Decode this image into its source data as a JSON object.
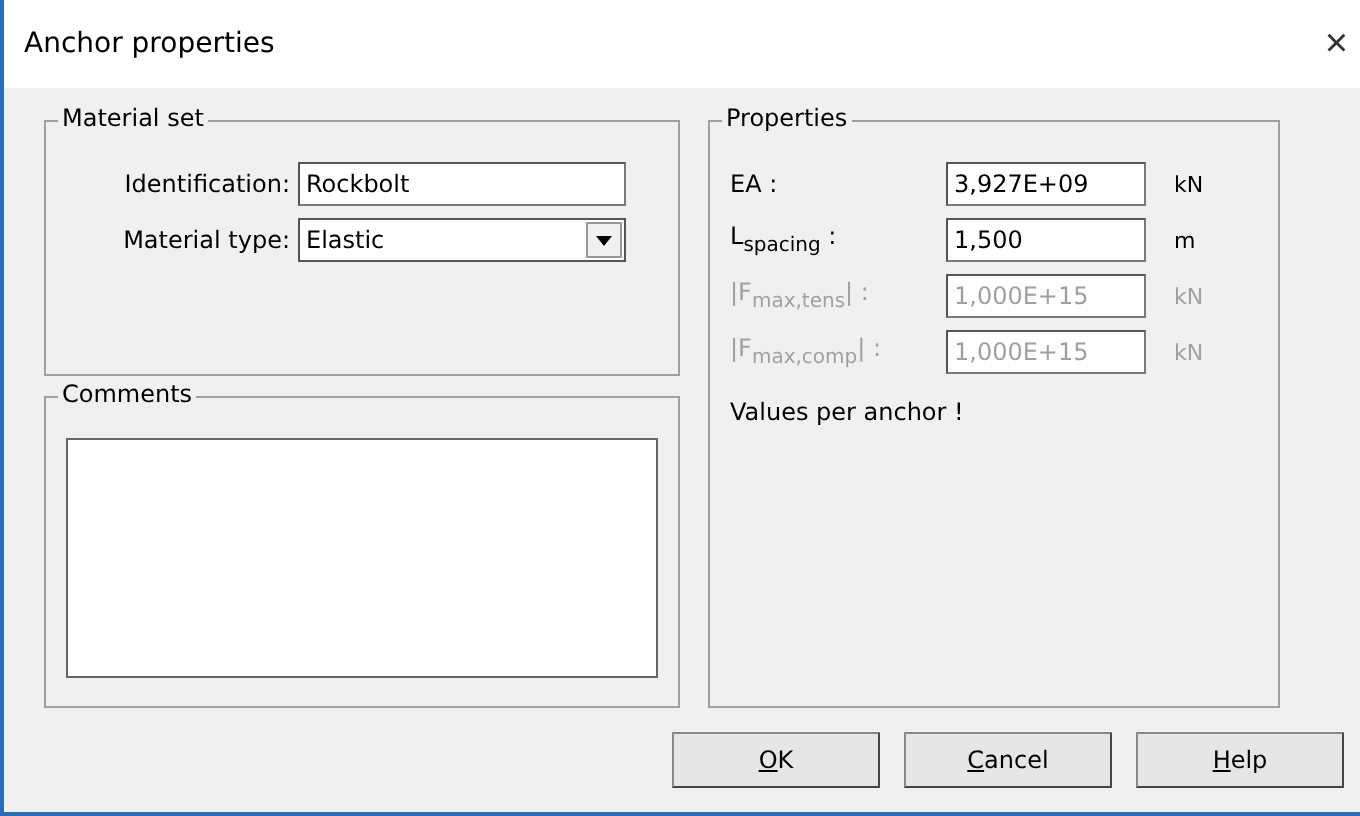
{
  "window": {
    "title": "Anchor properties",
    "close": "×"
  },
  "material_set": {
    "title": "Material set",
    "identification": {
      "label": "Identification:",
      "value": "Rockbolt"
    },
    "material_type": {
      "label": "Material type:",
      "value": "Elastic"
    }
  },
  "comments": {
    "title": "Comments"
  },
  "properties": {
    "title": "Properties",
    "rows": [
      {
        "label": "EA :",
        "value": "3,927E+09",
        "unit": "kN",
        "disabled": false
      },
      {
        "label": "L$_{spacing}$ :",
        "value": "1,500",
        "unit": "m",
        "disabled": false
      },
      {
        "label": "|F$_{max,tens}$| :",
        "value": "1,000E+15",
        "unit": "kN",
        "disabled": true
      },
      {
        "label": "|F$_{max,comp}$| :",
        "value": "1,000E+15",
        "unit": "kN",
        "disabled": true
      }
    ],
    "note": "Values per anchor !"
  },
  "buttons": [
    "OK",
    "Cancel",
    "Help"
  ]
}
